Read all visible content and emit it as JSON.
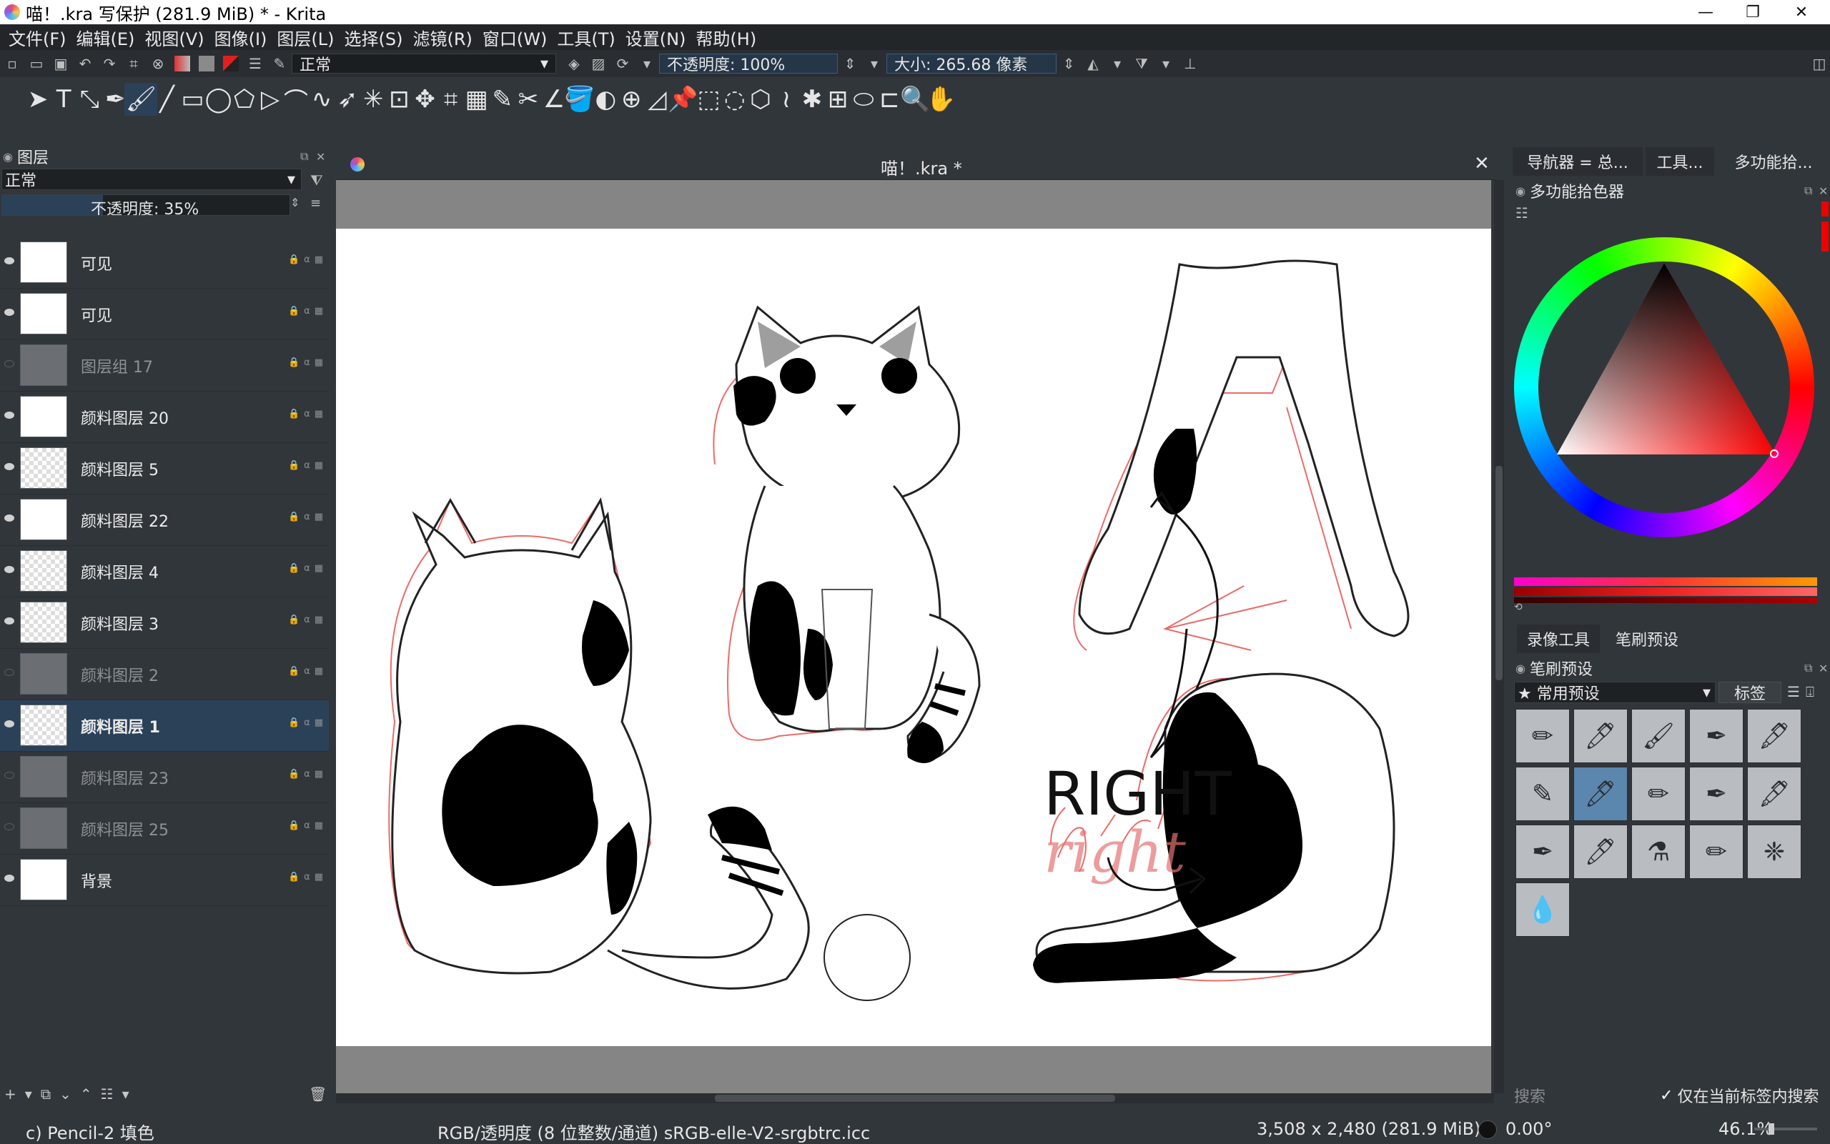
{
  "window": {
    "title": "喵！.kra 写保护  (281.9 MiB)  * - Krita",
    "minimize": "—",
    "maximize": "❐",
    "close": "✕"
  },
  "menu": [
    "文件(F)",
    "编辑(E)",
    "视图(V)",
    "图像(I)",
    "图层(L)",
    "选择(S)",
    "滤镜(R)",
    "窗口(W)",
    "工具(T)",
    "设置(N)",
    "帮助(H)"
  ],
  "options": {
    "blend_mode": "正常",
    "opacity_label": "不透明度:  100%",
    "size_label": "大小:  265.68 像素"
  },
  "tools": [
    "select-shapes-tool",
    "text-tool",
    "edit-shapes-tool",
    "calligraphy-tool",
    "freehand-brush-tool",
    "line-tool",
    "rectangle-tool",
    "ellipse-tool",
    "polygon-tool",
    "polyline-tool",
    "bezier-curve-tool",
    "freehand-path-tool",
    "dynamic-brush-tool",
    "multibrush-tool",
    "transform-tool",
    "move-tool",
    "crop-tool",
    "gradient-tool",
    "color-sampler-tool",
    "smart-patch-tool",
    "assistant-tool",
    "fill-tool",
    "enclosed-fill-tool",
    "reference-tool",
    "measure-tool",
    "pan-assistant-tool",
    "rect-select-tool",
    "ellipse-select-tool",
    "polygon-select-tool",
    "freehand-select-tool",
    "contiguous-select-tool",
    "similar-select-tool",
    "bezier-select-tool",
    "magnetic-select-tool",
    "zoom-tool",
    "pan-tool"
  ],
  "layers_panel": {
    "title": "图层",
    "blend_mode": "正常",
    "opacity_label": "不透明度:  35%",
    "layers": [
      {
        "name": "可见",
        "visible": true,
        "dim": false,
        "selected": false,
        "thumb": "white"
      },
      {
        "name": "可见",
        "visible": true,
        "dim": false,
        "selected": false,
        "thumb": "white"
      },
      {
        "name": "图层组 17",
        "visible": false,
        "dim": true,
        "selected": false,
        "thumb": "grey"
      },
      {
        "name": "颜料图层 20",
        "visible": true,
        "dim": false,
        "selected": false,
        "thumb": "white"
      },
      {
        "name": "颜料图层 5",
        "visible": true,
        "dim": false,
        "selected": false,
        "thumb": "checker"
      },
      {
        "name": "颜料图层 22",
        "visible": true,
        "dim": false,
        "selected": false,
        "thumb": "white"
      },
      {
        "name": "颜料图层 4",
        "visible": true,
        "dim": false,
        "selected": false,
        "thumb": "checker"
      },
      {
        "name": "颜料图层 3",
        "visible": true,
        "dim": false,
        "selected": false,
        "thumb": "checker"
      },
      {
        "name": "颜料图层 2",
        "visible": false,
        "dim": true,
        "selected": false,
        "thumb": "grey"
      },
      {
        "name": "颜料图层 1",
        "visible": true,
        "dim": false,
        "selected": true,
        "thumb": "checker"
      },
      {
        "name": "颜料图层 23",
        "visible": false,
        "dim": true,
        "selected": false,
        "thumb": "grey"
      },
      {
        "name": "颜料图层 25",
        "visible": false,
        "dim": true,
        "selected": false,
        "thumb": "grey"
      },
      {
        "name": "背景",
        "visible": true,
        "dim": false,
        "selected": false,
        "thumb": "white"
      }
    ]
  },
  "canvas": {
    "doc_title": "喵！.kra *",
    "text_right": "RIGHT",
    "text_right_sketch": "right"
  },
  "right_dock": {
    "tabs": [
      "导航器 = 总...",
      "工具...",
      "多功能拾..."
    ],
    "color_panel_title": "多功能拾色器",
    "lower_tabs": [
      "录像工具",
      "笔刷预设"
    ],
    "presets_title": "笔刷预设",
    "preset_filter": "★ 常用预设",
    "tag_button": "标签",
    "search_placeholder": "搜索",
    "search_in_tag": "仅在当前标签内搜索",
    "preset_count": 16,
    "selected_preset": 6
  },
  "status": {
    "brush": "c) Pencil-2 填色",
    "color_info": "RGB/透明度 (8 位整数/通道)  sRGB-elle-V2-srgbtrc.icc",
    "image_size": "3,508 x 2,480 (281.9 MiB)",
    "rotation": "0.00°",
    "zoom": "46.1%"
  },
  "colors": {
    "accent": "#2b4158",
    "panel": "#31363b",
    "menubar": "#232629"
  }
}
